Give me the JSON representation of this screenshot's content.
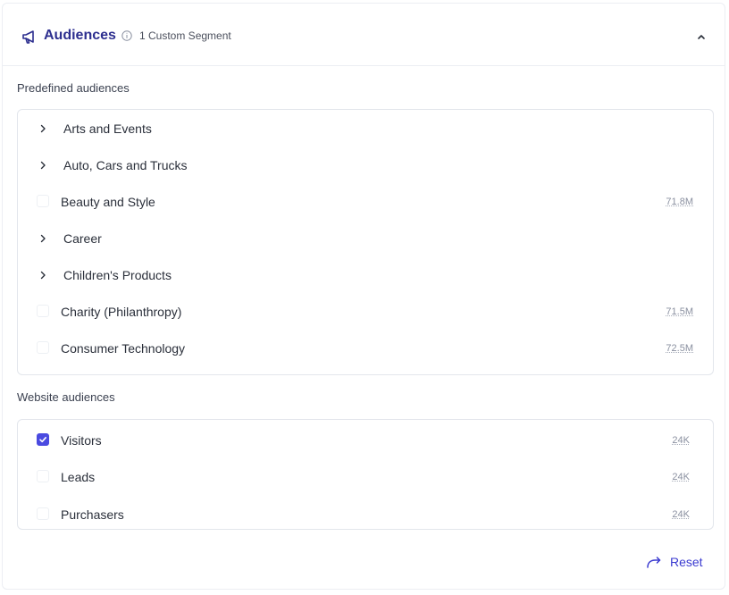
{
  "header": {
    "title": "Audiences",
    "subtitle": "1 Custom Segment",
    "icons": {
      "leading": "megaphone-icon",
      "info": "info-icon",
      "collapse": "chevron-up-icon"
    }
  },
  "predefined": {
    "label": "Predefined audiences",
    "items": [
      {
        "label": "Arts and Events",
        "type": "expandable"
      },
      {
        "label": "Auto, Cars and Trucks",
        "type": "expandable"
      },
      {
        "label": "Beauty and Style",
        "type": "checkbox",
        "checked": false,
        "size": "71.8M"
      },
      {
        "label": "Career",
        "type": "expandable"
      },
      {
        "label": "Children's Products",
        "type": "expandable"
      },
      {
        "label": "Charity (Philanthropy)",
        "type": "checkbox",
        "checked": false,
        "size": "71.5M"
      },
      {
        "label": "Consumer Technology",
        "type": "checkbox",
        "checked": false,
        "size": "72.5M"
      }
    ]
  },
  "website": {
    "label": "Website audiences",
    "items": [
      {
        "label": "Visitors",
        "checked": true,
        "size": "24K"
      },
      {
        "label": "Leads",
        "checked": false,
        "size": "24K"
      },
      {
        "label": "Purchasers",
        "checked": false,
        "size": "24K"
      }
    ]
  },
  "footer": {
    "reset_label": "Reset",
    "reset_icon": "redo-arrow-icon"
  },
  "colors": {
    "accent": "#4a4ae0",
    "title": "#2d2f8f",
    "link": "#3a3ad0"
  }
}
